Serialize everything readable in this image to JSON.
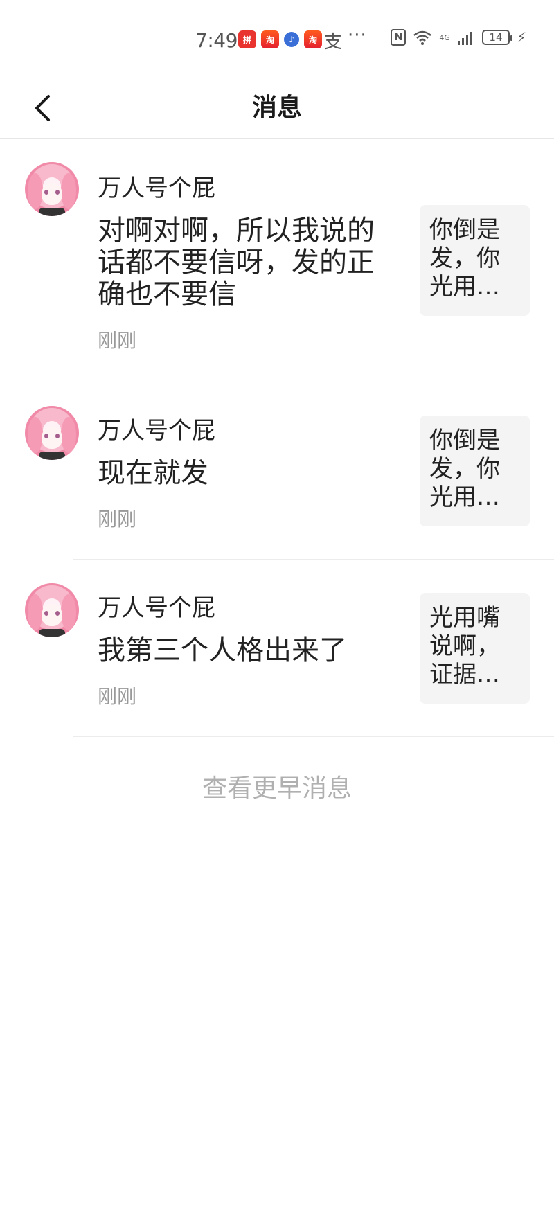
{
  "status_bar": {
    "time": "7:49",
    "app_icons": [
      "pinduoduo-icon",
      "taobao-icon",
      "music-icon",
      "taobao-icon"
    ],
    "misc_char": "支",
    "more": "···",
    "network": "4G",
    "battery": "14"
  },
  "header": {
    "title": "消息",
    "back_icon": "chevron-left-icon"
  },
  "messages": [
    {
      "sender": "万人号个屁",
      "text": "对啊对啊，所以我说的话都不要信呀，发的正确也不要信",
      "time": "刚刚",
      "quote": "你倒是发，你光用…"
    },
    {
      "sender": "万人号个屁",
      "text": "现在就发",
      "time": "刚刚",
      "quote": "你倒是发，你光用…"
    },
    {
      "sender": "万人号个屁",
      "text": "我第三个人格出来了",
      "time": "刚刚",
      "quote": "光用嘴说啊，证据…"
    }
  ],
  "footer": {
    "earlier_label": "查看更早消息"
  },
  "colors": {
    "text_primary": "#222222",
    "text_secondary": "#999999",
    "quote_bg": "#f4f4f4",
    "link_gray": "#b0b0b0"
  }
}
